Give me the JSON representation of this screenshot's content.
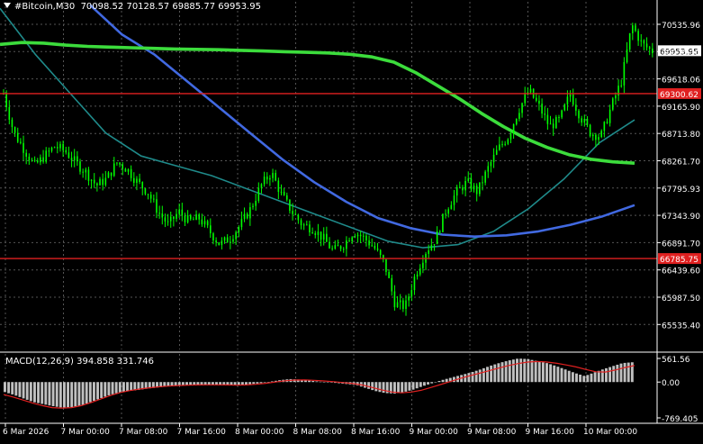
{
  "header": {
    "symbol": "#Bitcoin,M30",
    "ohlc": "70098.52 70128.57 69885.77 69953.95"
  },
  "macd_label": "MACD(12,26,9) 394.858 331.746",
  "colors": {
    "background": "#000000",
    "grid": "#555555",
    "candle": "#00ff00",
    "ma_fast": "#3cdc3c",
    "ma_blue": "#4169e1",
    "ma_teal": "#1f8a8a",
    "level_line": "#e02020",
    "macd_hist": "#c0c0c0",
    "macd_signal": "#e02020"
  },
  "price_axis": {
    "labels": [
      "70535.96",
      "70070.10",
      "69618.06",
      "69165.90",
      "68713.80",
      "68261.70",
      "67795.93",
      "67343.90",
      "66891.70",
      "66439.60",
      "65987.50",
      "65535.40"
    ]
  },
  "price_tags": {
    "current": "69953.95",
    "resistance": "69300.62",
    "support": "66785.75"
  },
  "macd_axis": {
    "labels": [
      "561.56",
      "0.00",
      "-769.405"
    ]
  },
  "time_axis": {
    "labels": [
      "6 Mar 2026",
      "7 Mar 00:00",
      "7 Mar 08:00",
      "7 Mar 16:00",
      "8 Mar 00:00",
      "8 Mar 08:00",
      "8 Mar 16:00",
      "9 Mar 00:00",
      "9 Mar 08:00",
      "9 Mar 16:00",
      "10 Mar 00:00"
    ]
  },
  "chart_data": {
    "type": "candlestick",
    "ylim": [
      65400,
      70700
    ],
    "levels": [
      69300.62,
      66785.75
    ],
    "last_price": 69953.95,
    "close_path": [
      69300,
      68700,
      68450,
      68200,
      68350,
      68500,
      68420,
      68250,
      68100,
      67900,
      68000,
      68250,
      68150,
      67950,
      67800,
      67500,
      67300,
      67500,
      67350,
      67400,
      67200,
      67000,
      67100,
      67300,
      67550,
      67900,
      68100,
      67750,
      67500,
      67300,
      67250,
      67100,
      66900,
      67000,
      67200,
      67100,
      66950,
      66700,
      66100,
      66050,
      66550,
      66900,
      67100,
      67550,
      67800,
      67950,
      67800,
      68150,
      68450,
      68650,
      69050,
      69350,
      69100,
      68800,
      68900,
      69300,
      68950,
      68700,
      68650,
      69100,
      69500,
      70350,
      70050,
      69950
    ],
    "macd_hist_path": [
      -200,
      -260,
      -330,
      -400,
      -440,
      -480,
      -510,
      -500,
      -470,
      -400,
      -330,
      -260,
      -210,
      -180,
      -160,
      -130,
      -110,
      -90,
      -70,
      -60,
      -60,
      -55,
      -50,
      -60,
      -70,
      -60,
      -40,
      -20,
      10,
      40,
      60,
      50,
      30,
      10,
      -5,
      -20,
      -40,
      -60,
      -120,
      -180,
      -220,
      -230,
      -200,
      -150,
      -80,
      -20,
      40,
      90,
      140,
      190,
      250,
      320,
      380,
      430,
      470,
      460,
      420,
      380,
      320,
      250,
      180,
      120,
      190,
      260,
      320,
      380,
      395
    ],
    "macd_signal_path": [
      -250,
      -300,
      -360,
      -420,
      -470,
      -510,
      -520,
      -510,
      -470,
      -410,
      -340,
      -270,
      -210,
      -170,
      -140,
      -115,
      -95,
      -80,
      -70,
      -62,
      -58,
      -55,
      -55,
      -58,
      -62,
      -58,
      -44,
      -25,
      0,
      25,
      40,
      42,
      35,
      22,
      8,
      -10,
      -30,
      -60,
      -110,
      -160,
      -200,
      -215,
      -200,
      -165,
      -110,
      -50,
      10,
      70,
      125,
      175,
      225,
      280,
      330,
      370,
      400,
      410,
      400,
      375,
      340,
      300,
      250,
      205,
      200,
      240,
      290,
      330
    ],
    "ma_fast_path": [
      70050,
      70080,
      70070,
      70040,
      70020,
      70010,
      70000,
      69990,
      69980,
      69975,
      69970,
      69960,
      69950,
      69940,
      69930,
      69920,
      69900,
      69860,
      69780,
      69620,
      69420,
      69220,
      69000,
      68800,
      68620,
      68480,
      68370,
      68300,
      68260,
      68240
    ],
    "ma_blue_path": [
      70650,
      70200,
      69900,
      69500,
      69100,
      68700,
      68300,
      67950,
      67650,
      67400,
      67250,
      67150,
      67120,
      67140,
      67200,
      67300,
      67430,
      67600
    ],
    "ma_teal_path": [
      70600,
      69900,
      69300,
      68700,
      68350,
      68200,
      68050,
      67850,
      67650,
      67450,
      67250,
      67050,
      66950,
      67000,
      67200,
      67550,
      68000,
      68550,
      68900
    ]
  }
}
